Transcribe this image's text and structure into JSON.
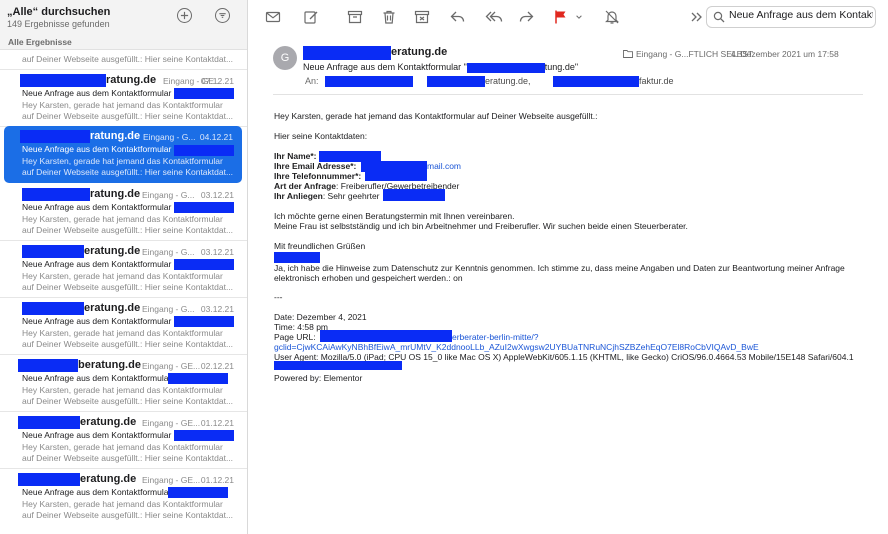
{
  "list": {
    "title": "„Alle“ durchsuchen",
    "count": "149 Ergebnisse gefunden",
    "section": "Alle Ergebnisse",
    "top_preview": "auf Deiner Webseite ausgefüllt.: Hier seine Kontaktdat...",
    "messages": [
      {
        "sender": "ratung.de",
        "folder": "Eingang - GE...",
        "date": "07.12.21",
        "subject": "Neue Anfrage aus dem Kontaktformular",
        "preview1": "Hey Karsten, gerade hat jemand das Kontaktformular",
        "preview2": "auf Deiner Webseite ausgefüllt.: Hier seine Kontaktdat..."
      },
      {
        "sender": "ratung.de",
        "folder": "Eingang - G...",
        "date": "04.12.21",
        "subject": "Neue Anfrage aus dem Kontaktformular",
        "preview1": "Hey Karsten, gerade hat jemand das Kontaktformular",
        "preview2": "auf Deiner Webseite ausgefüllt.: Hier seine Kontaktdat..."
      },
      {
        "sender": "ratung.de",
        "folder": "Eingang - G...",
        "date": "03.12.21",
        "subject": "Neue Anfrage aus dem Kontaktformular",
        "preview1": "Hey Karsten, gerade hat jemand das Kontaktformular",
        "preview2": "auf Deiner Webseite ausgefüllt.: Hier seine Kontaktdat..."
      },
      {
        "sender": "eratung.de",
        "folder": "Eingang - G...",
        "date": "03.12.21",
        "subject": "Neue Anfrage aus dem Kontaktformular",
        "preview1": "Hey Karsten, gerade hat jemand das Kontaktformular",
        "preview2": "auf Deiner Webseite ausgefüllt.: Hier seine Kontaktdat..."
      },
      {
        "sender": "eratung.de",
        "folder": "Eingang - G...",
        "date": "03.12.21",
        "subject": "Neue Anfrage aus dem Kontaktformular",
        "preview1": "Hey Karsten, gerade hat jemand das Kontaktformular",
        "preview2": "auf Deiner Webseite ausgefüllt.: Hier seine Kontaktdat..."
      },
      {
        "sender": "beratung.de",
        "folder": "Eingang - GE...",
        "date": "02.12.21",
        "subject": "Neue Anfrage aus dem Kontaktformula",
        "preview1": "Hey Karsten, gerade hat jemand das Kontaktformular",
        "preview2": "auf Deiner Webseite ausgefüllt.: Hier seine Kontaktdat..."
      },
      {
        "sender": "eratung.de",
        "folder": "Eingang - GE...",
        "date": "01.12.21",
        "subject": "Neue Anfrage aus dem Kontaktformular",
        "preview1": "Hey Karsten, gerade hat jemand das Kontaktformular",
        "preview2": "auf Deiner Webseite ausgefüllt.: Hier seine Kontaktdat..."
      },
      {
        "sender": "eratung.de",
        "folder": "Eingang - GE...",
        "date": "01.12.21",
        "subject": "Neue Anfrage aus dem Kontaktformula",
        "preview1": "Hey Karsten, gerade hat jemand das Kontaktformular",
        "preview2": "auf Deiner Webseite ausgefüllt.: Hier seine Kontaktdat..."
      }
    ]
  },
  "toolbar": {
    "search_value": "Neue Anfrage aus dem Kontakt",
    "flag_color": "#e0281f",
    "icons": [
      "envelope-icon",
      "compose-icon",
      "archive-icon",
      "trash-icon",
      "junk-icon",
      "reply-icon",
      "reply-all-icon",
      "forward-icon",
      "flag-icon",
      "mute-icon",
      "more-icon",
      "search-icon"
    ]
  },
  "mail": {
    "avatar": "G",
    "from": "eratung.de",
    "subject_prefix": "Neue Anfrage aus dem Kontaktformular \"",
    "subject_suffix": "tung.de\"",
    "to_label": "An:",
    "to_2": "eratung.de,",
    "to_3": "faktur.de",
    "folder": "Eingang - G...FTLICH SELBST",
    "date": "4. Dezember 2021 um 17:58",
    "greeting": "Hey Karsten, gerade hat jemand das Kontaktformular auf Deiner Webseite ausgefüllt.:",
    "intro": "Hier seine Kontaktdaten:",
    "name_label": "Ihr Name*:",
    "email_label": "Ihre Email Adresse*:",
    "email_suffix": "mail.com",
    "phone_label": "Ihre Telefonnummer*:",
    "type_label": "Art der Anfrage",
    "type_value": ": Freiberufler/Gewerbetreibender",
    "concern_label": "Ihr Anliegen",
    "concern_value": ": Sehr geehrter",
    "msg1": "Ich möchte gerne einen Beratungstermin mit Ihnen vereinbaren.",
    "msg2": "Meine Frau ist selbstständig und ich bin Arbeitnehmer und Freiberufler. Wir suchen beide einen Steuerberater.",
    "regards": "Mit freundlichen Grüßen",
    "consent1": "Ja, ich habe die Hinweise zum Datenschutz zur Kenntnis genommen. Ich stimme zu, dass meine Angaben und Daten zur Beantwortung meiner Anfrage",
    "consent2": "elektronisch erhoben und gespeichert werden.: on",
    "dashes": "---",
    "date_line": "Date: Dezember 4, 2021",
    "time_line": "Time: 4:58 pm",
    "page_url_label": "Page URL:",
    "url1": "erberater-berlin-mitte/?",
    "url2": "gclid=CjwKCAiAwKyNBhBfEiwA_mrUMtV_K2ddnooLLb_AZuI2wXwgsw2UYBUaTNRuNCjhSZBZehEqO7El8RoCbVIQAvD_BwE",
    "user_agent": "User Agent: Mozilla/5.0 (iPad; CPU OS 15_0 like Mac OS X) AppleWebKit/605.1.15 (KHTML, like Gecko) CriOS/96.0.4664.53 Mobile/15E148 Safari/604.1",
    "powered": "Powered by: Elementor"
  }
}
